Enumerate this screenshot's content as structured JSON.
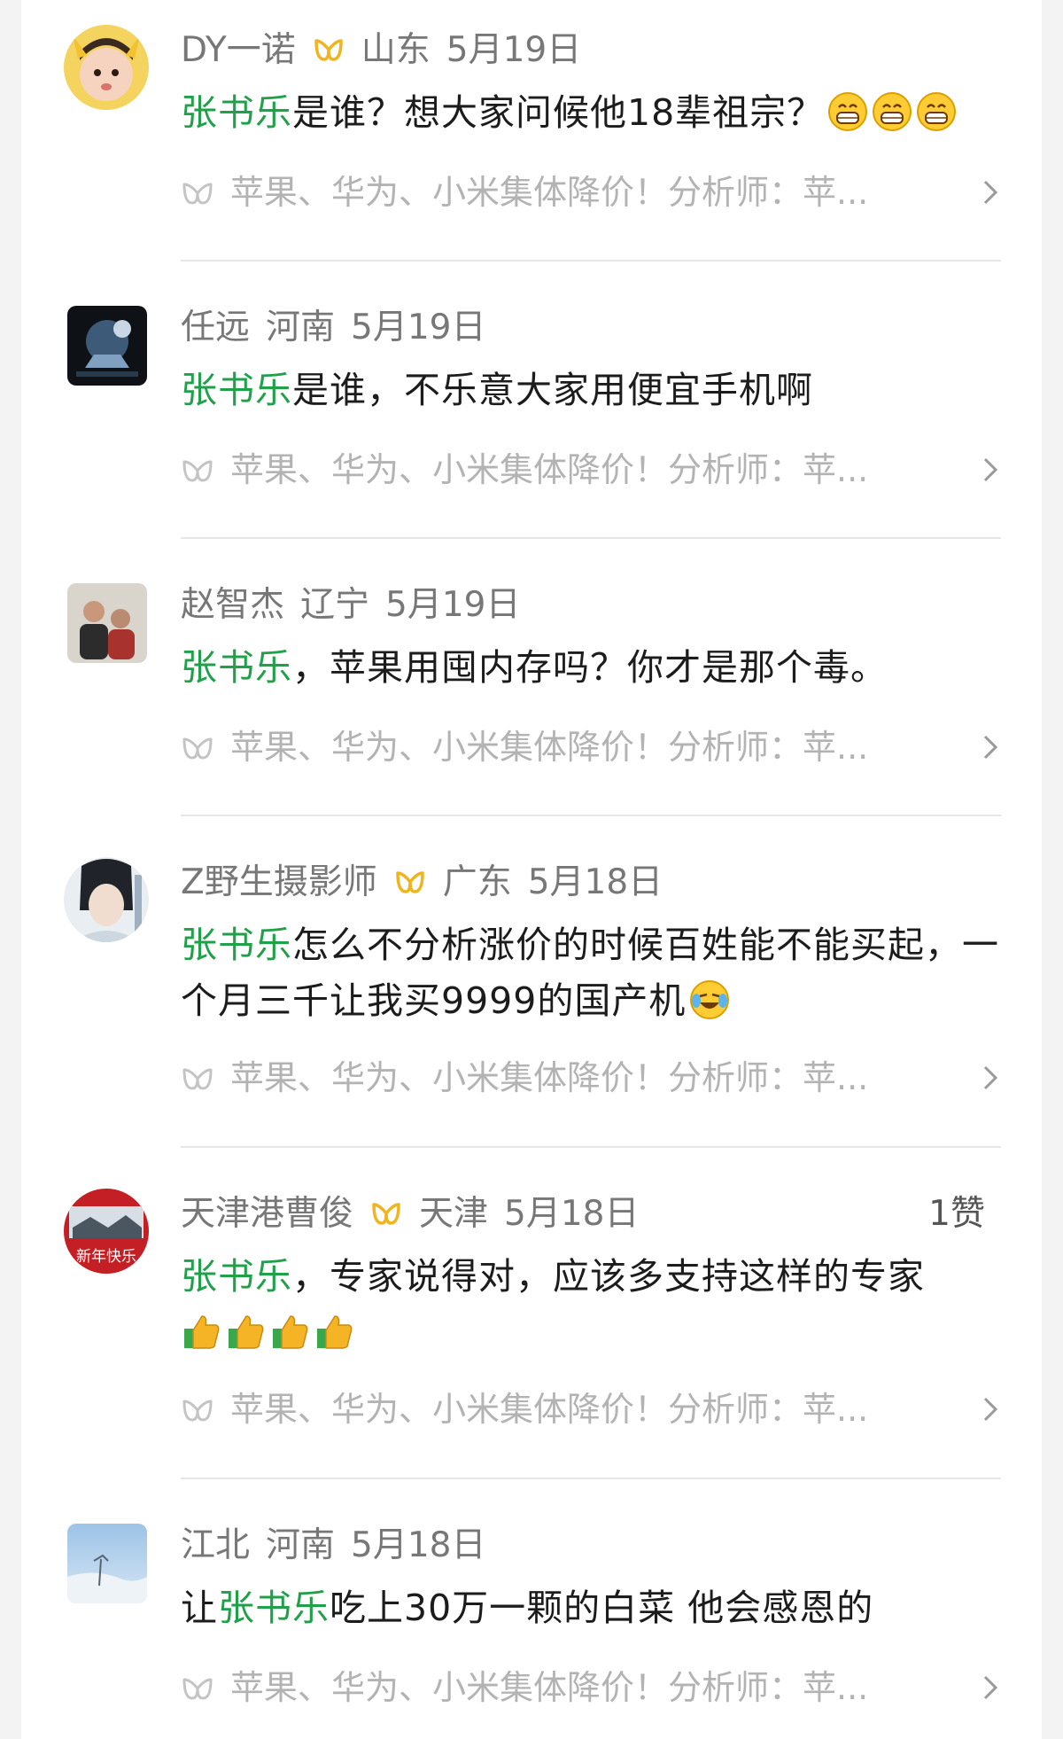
{
  "comments": [
    {
      "user": "DY一诺",
      "region": "山东",
      "date": "5月19日",
      "likes": "",
      "segments": [
        {
          "t": "张书乐",
          "hl": true
        },
        {
          "t": "是谁？想大家问候他18辈祖宗？",
          "hl": false
        }
      ],
      "emoji": "grin-emoji",
      "emoji_count": 3,
      "source": "苹果、华为、小米集体降价！分析师：苹..."
    },
    {
      "user": "任远",
      "region": "河南",
      "date": "5月19日",
      "likes": "",
      "segments": [
        {
          "t": "张书乐",
          "hl": true
        },
        {
          "t": "是谁，不乐意大家用便宜手机啊",
          "hl": false
        }
      ],
      "source": "苹果、华为、小米集体降价！分析师：苹..."
    },
    {
      "user": "赵智杰",
      "region": "辽宁",
      "date": "5月19日",
      "likes": "",
      "segments": [
        {
          "t": "张书乐",
          "hl": true
        },
        {
          "t": "，苹果用囤内存吗？你才是那个毒。",
          "hl": false
        }
      ],
      "source": "苹果、华为、小米集体降价！分析师：苹..."
    },
    {
      "user": "Z野生摄影师",
      "region": "广东",
      "date": "5月18日",
      "likes": "",
      "segments": [
        {
          "t": "张书乐",
          "hl": true
        },
        {
          "t": "怎么不分析涨价的时候百姓能不能买起，一个月三千让我买9999的国产机",
          "hl": false
        }
      ],
      "emoji": "laugh-cry-emoji",
      "emoji_count": 1,
      "source": "苹果、华为、小米集体降价！分析师：苹..."
    },
    {
      "user": "天津港曹俊",
      "region": "天津",
      "date": "5月18日",
      "likes": "1赞",
      "segments": [
        {
          "t": "张书乐",
          "hl": true
        },
        {
          "t": "，专家说得对，应该多支持这样的专家",
          "hl": false
        }
      ],
      "emoji": "thumbs-up-emoji",
      "emoji_count": 4,
      "avatar_text": "新年快乐",
      "source": "苹果、华为、小米集体降价！分析师：苹..."
    },
    {
      "user": "江北",
      "region": "河南",
      "date": "5月18日",
      "likes": "",
      "segments": [
        {
          "t": "让",
          "hl": false
        },
        {
          "t": "张书乐",
          "hl": true
        },
        {
          "t": "吃上30万一颗的白菜 他会感恩的",
          "hl": false
        }
      ],
      "source": "苹果、华为、小米集体降价！分析师：苹..."
    }
  ],
  "colors": {
    "highlight": "#21a04a",
    "badge": "#f0b41e",
    "text": "#1c1c1c",
    "meta": "#777777",
    "source": "#b3b3b3"
  }
}
